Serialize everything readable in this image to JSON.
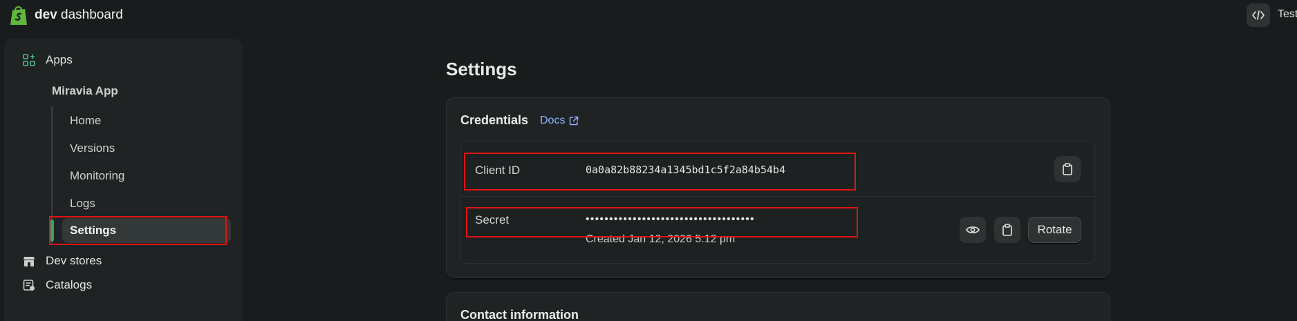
{
  "brand": {
    "bold": "dev",
    "rest": " dashboard"
  },
  "topbar": {
    "store_label": "Test"
  },
  "sidebar": {
    "apps_label": "Apps",
    "app_name": "Miravia App",
    "sub_items": [
      "Home",
      "Versions",
      "Monitoring",
      "Logs",
      "Settings"
    ],
    "dev_stores_label": "Dev stores",
    "catalogs_label": "Catalogs"
  },
  "main": {
    "page_title": "Settings",
    "credentials": {
      "title": "Credentials",
      "docs_label": "Docs",
      "client_id_label": "Client ID",
      "client_id_value": "0a0a82b88234a1345bd1c5f2a84b54b4",
      "secret_label": "Secret",
      "secret_value": "••••••••••••••••••••••••••••••••••••",
      "created_text": "Created Jan 12, 2026 5:12 pm",
      "rotate_label": "Rotate"
    },
    "contact": {
      "title": "Contact information"
    }
  },
  "colors": {
    "background": "#191c1d",
    "card": "#1f2324",
    "accent_green": "#34a36a",
    "link": "#8fb3ff",
    "highlight": "#e01414"
  },
  "icons": [
    "shopify-bag-icon",
    "code-icon",
    "apps-icon",
    "store-icon",
    "catalog-icon",
    "external-link-icon",
    "clipboard-icon",
    "eye-icon"
  ]
}
